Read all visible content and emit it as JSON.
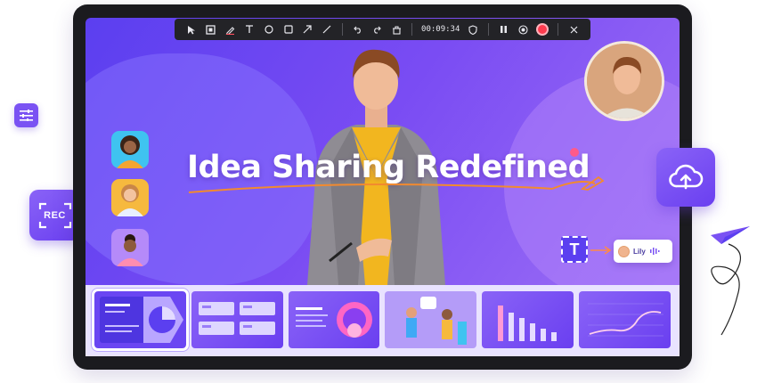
{
  "headline": "Idea Sharing Redefined",
  "toolbar": {
    "time": "00:09:34",
    "items": [
      "cursor-icon",
      "region-icon",
      "pen-icon",
      "text-icon",
      "circle-icon",
      "rectangle-icon",
      "arrow-icon",
      "line-icon",
      "undo-icon",
      "redo-icon",
      "clear-icon",
      "shield-icon",
      "pause-icon",
      "camera-icon",
      "record-icon",
      "close-icon"
    ]
  },
  "left_widgets": {
    "rec_label": "REC"
  },
  "lily": {
    "name": "Lily"
  },
  "text_tool": {
    "label": "T"
  },
  "thumbnails": [
    {
      "id": "slide-pie",
      "active": true
    },
    {
      "id": "slide-list"
    },
    {
      "id": "slide-circle"
    },
    {
      "id": "slide-people"
    },
    {
      "id": "slide-bars"
    },
    {
      "id": "slide-line"
    }
  ],
  "colors": {
    "accent": "#6a3ff0",
    "record": "#ff3b4f",
    "highlight": "#f28a2f"
  }
}
